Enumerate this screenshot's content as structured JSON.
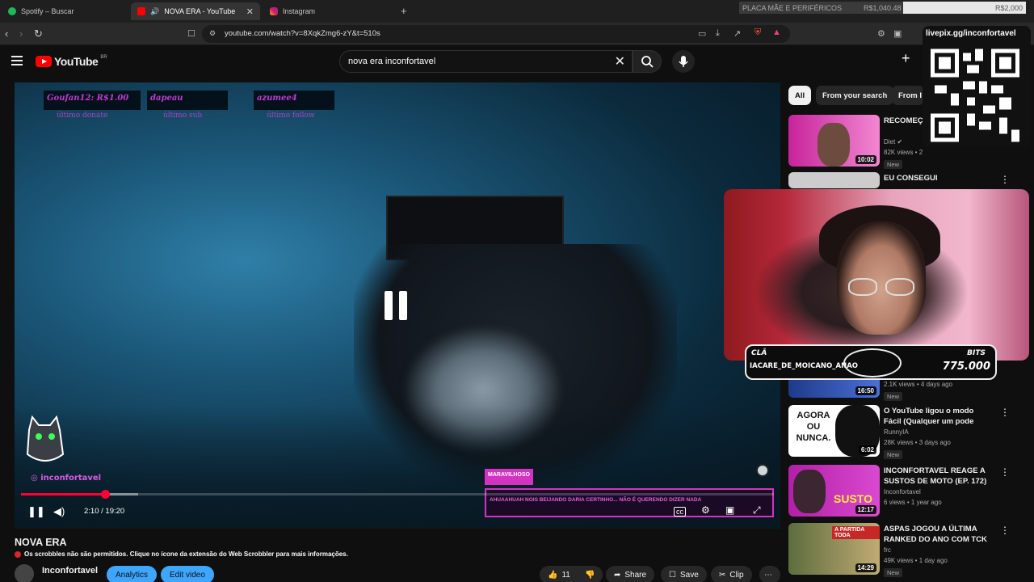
{
  "tabs": [
    {
      "label": "Spotify – Buscar"
    },
    {
      "label": "NOVA ERA - YouTube"
    },
    {
      "label": "Instagram"
    }
  ],
  "budget": {
    "label": "PLACA MÃE E PERIFÉRICOS",
    "current": "R$1,040.48",
    "goal": "R$2,000"
  },
  "url": "youtube.com/watch?v=8XqkZmg6-zY&t=510s",
  "youtube": {
    "logo": "YouTube",
    "region": "BR"
  },
  "search": {
    "value": "nova era inconfortavel"
  },
  "player": {
    "donors": [
      {
        "name": "Goufan12: R$1.00",
        "sub": "último donate"
      },
      {
        "name": "dapeau",
        "sub": "último sub"
      },
      {
        "name": "azumee4",
        "sub": "último follow"
      }
    ],
    "instagram_handle": "inconfortavel",
    "chat_name": "MARAVILHOSO",
    "chat_message": "AHUAAHUAH NOIS BEIJANDO DARIA CERTINHO... NÃO É QUERENDO DIZER NADA",
    "time_current": "2:10",
    "time_total": "19:20",
    "progress_fraction": 0.112
  },
  "video": {
    "title": "NOVA ERA",
    "scrobble_note": "Os scrobbles não são permitidos. Clique no ícone da extensão do Web Scrobbler para mais informações.",
    "channel": "Inconfortavel",
    "analytics_label": "Analytics",
    "edit_label": "Edit video",
    "likes": "11",
    "share_label": "Share",
    "save_label": "Save",
    "clip_label": "Clip"
  },
  "chips": [
    "All",
    "From your search",
    "From I"
  ],
  "recommendations": [
    {
      "title": "RECOMEÇO",
      "channel": "Diet",
      "meta": "82K views • 2",
      "duration": "10:02",
      "new": "New"
    },
    {
      "title": "EU CONSEGUI",
      "channel": "",
      "meta": "",
      "duration": "",
      "new": ""
    },
    {
      "title": "",
      "channel": "",
      "meta": "2.1K views • 4 days ago",
      "duration": "16:50",
      "new": "New"
    },
    {
      "title": "O YouTube ligou o modo Fácil (Qualquer um pode bombar e...",
      "channel": "RunnyIA",
      "meta": "28K views • 3 days ago",
      "duration": "6:02",
      "new": "New"
    },
    {
      "title": "INCONFORTAVEL REAGE A SUSTOS DE MOTO (EP. 172)",
      "channel": "Inconfortavel",
      "meta": "6 views • 1 year ago",
      "duration": "12:17",
      "new": ""
    },
    {
      "title": "ASPAS JOGOU A ÚLTIMA RANKED DO ANO COM TCK E ...",
      "channel": "frc",
      "meta": "49K views • 1 day ago",
      "duration": "14:29",
      "new": "New"
    }
  ],
  "thumb_texts": {
    "agora": "AGORA OU NUNCA.",
    "susto": "SUSTO",
    "partida": "A PARTIDA TODA"
  },
  "overlay": {
    "left_top": "CLÃ",
    "left_name": "IACARE_DE_MOICANO_ANAO",
    "right_top": "BITS",
    "right_value": "775.000"
  },
  "qr": {
    "label": "livepix.gg/inconfortavel"
  }
}
